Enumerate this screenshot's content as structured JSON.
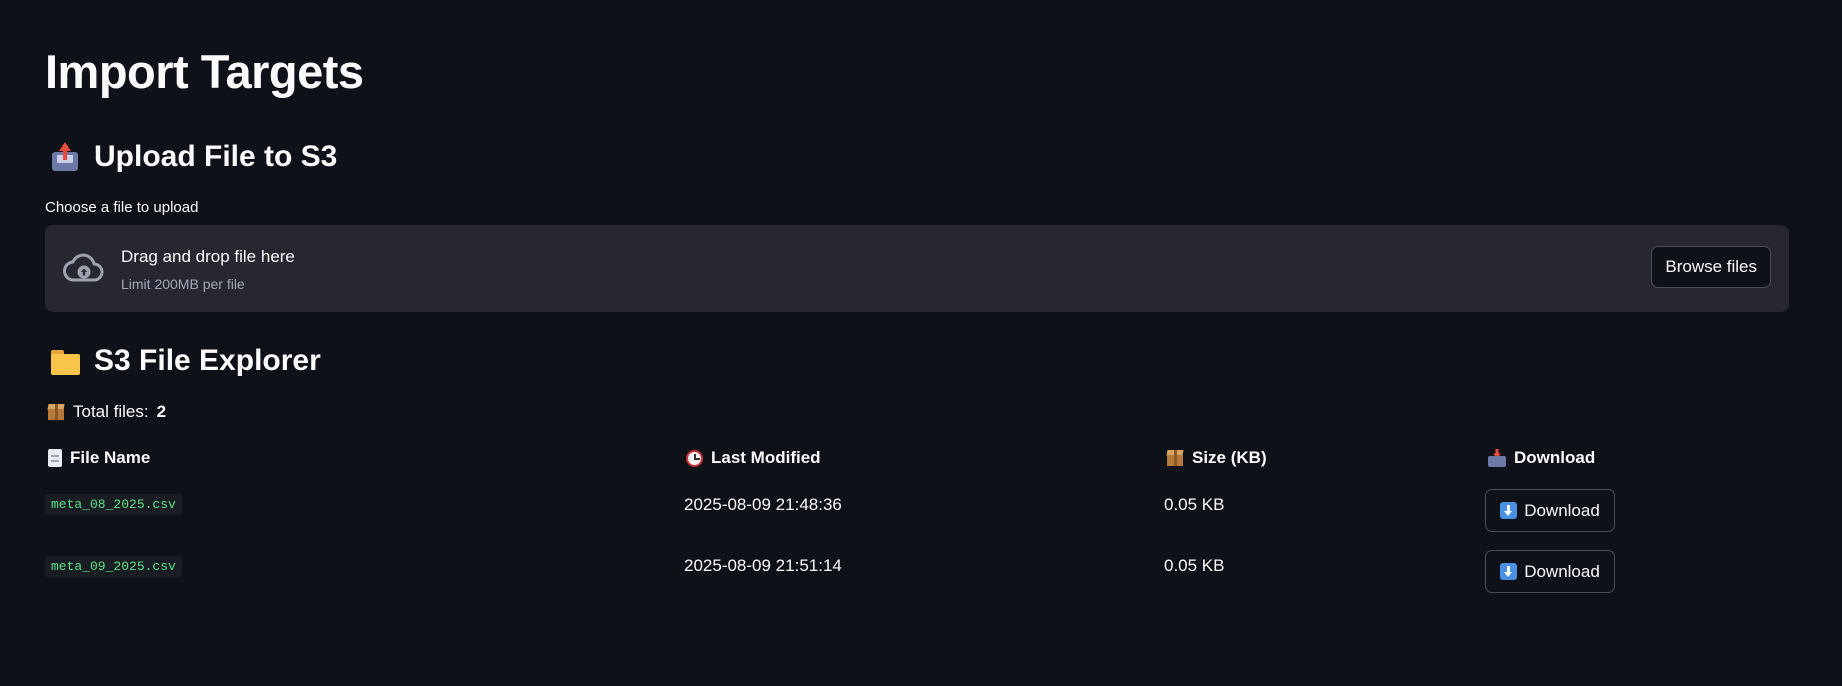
{
  "page": {
    "title": "Import Targets"
  },
  "upload": {
    "heading": "Upload File to S3",
    "heading_icon": "inbox-tray-up-icon",
    "field_label": "Choose a file to upload",
    "dropzone_title": "Drag and drop file here",
    "dropzone_limit": "Limit 200MB per file",
    "browse_label": "Browse files",
    "cloud_icon": "cloud-upload-icon"
  },
  "explorer": {
    "heading": "S3 File Explorer",
    "heading_icon": "folder-icon",
    "total_prefix": "Total files:",
    "total_count": "2",
    "columns": {
      "file_name": "File Name",
      "last_modified": "Last Modified",
      "size": "Size (KB)",
      "download": "Download"
    },
    "rows": [
      {
        "file_name": "meta_08_2025.csv",
        "last_modified": "2025-08-09 21:48:36",
        "size": "0.05 KB",
        "download_label": "Download"
      },
      {
        "file_name": "meta_09_2025.csv",
        "last_modified": "2025-08-09 21:51:14",
        "size": "0.05 KB",
        "download_label": "Download"
      }
    ]
  },
  "colors": {
    "background": "#0e1117",
    "dropzone": "#262730",
    "code_text": "#5ce488",
    "button_border": "#4a4d57"
  }
}
